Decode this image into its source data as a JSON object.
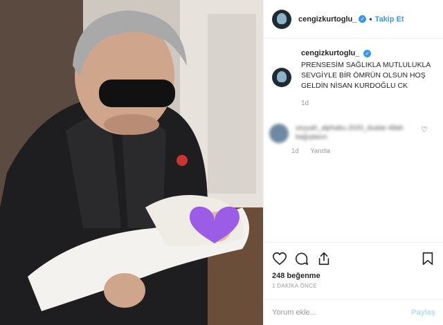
{
  "post": {
    "username": "cengizkurtoglu_",
    "follow_label": "Takip Et",
    "dot": "•"
  },
  "caption": {
    "username": "cengizkurtoglu_",
    "text": "PRENSESİM SAĞLIKLA MUTLULUKLA SEVGİYLE BİR ÖMRÜN OLSUN HOŞ GELDİN NİSAN KURDOĞLU CK",
    "time": "1d"
  },
  "comment": {
    "text_blurred": "seyyah_alphabu.2020_dualar Allah bağışlasın",
    "time": "1d",
    "reply_label": "Yanıtla"
  },
  "stats": {
    "likes": "248 beğenme",
    "time_ago": "1 DAKİKA ÖNCE"
  },
  "comment_box": {
    "placeholder": "Yorum ekle...",
    "post_label": "Paylaş"
  },
  "colors": {
    "accent": "#3897f0",
    "muted": "#999999",
    "post_disabled": "#b2dffc",
    "emoji_heart": "#9b5de5"
  },
  "icons": [
    "verified-icon",
    "heart-icon",
    "comment-icon",
    "share-icon",
    "bookmark-icon",
    "purple-heart-emoji"
  ]
}
